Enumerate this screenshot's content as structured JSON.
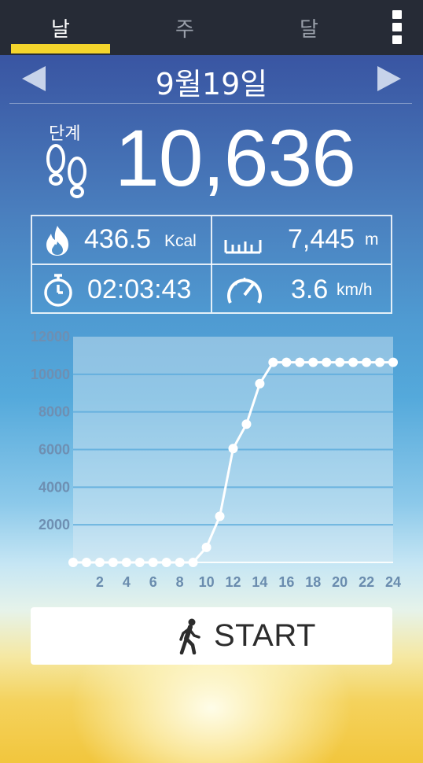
{
  "tabs": [
    {
      "label": "날",
      "active": true
    },
    {
      "label": "주",
      "active": false
    },
    {
      "label": "달",
      "active": false
    }
  ],
  "date": {
    "title": "9월19일"
  },
  "steps": {
    "label": "단계",
    "value": "10,636"
  },
  "stats": {
    "calories": {
      "value": "436.5",
      "unit": "Kcal"
    },
    "distance": {
      "value": "7,445",
      "unit": "m"
    },
    "duration": {
      "value": "02:03:43"
    },
    "speed": {
      "value": "3.6",
      "unit": "km/h"
    }
  },
  "chart_data": {
    "type": "line",
    "x": [
      0,
      1,
      2,
      3,
      4,
      5,
      6,
      7,
      8,
      9,
      10,
      11,
      12,
      13,
      14,
      15,
      16,
      17,
      18,
      19,
      20,
      21,
      22,
      23,
      24
    ],
    "y": [
      0,
      0,
      0,
      0,
      0,
      0,
      0,
      0,
      0,
      0,
      800,
      2450,
      6050,
      7350,
      9500,
      10636,
      10636,
      10636,
      10636,
      10636,
      10636,
      10636,
      10636,
      10636,
      10636
    ],
    "xticks": [
      "2",
      "4",
      "6",
      "8",
      "10",
      "12",
      "14",
      "16",
      "18",
      "20",
      "22",
      "24"
    ],
    "yticks": [
      "2000",
      "4000",
      "6000",
      "8000",
      "10000",
      "12000"
    ],
    "xlim": [
      0,
      24
    ],
    "ylim": [
      0,
      12000
    ],
    "grid": true
  },
  "start_button": {
    "label": "START"
  },
  "colors": {
    "accent": "#f4d52c",
    "tabbar": "#262b36"
  }
}
